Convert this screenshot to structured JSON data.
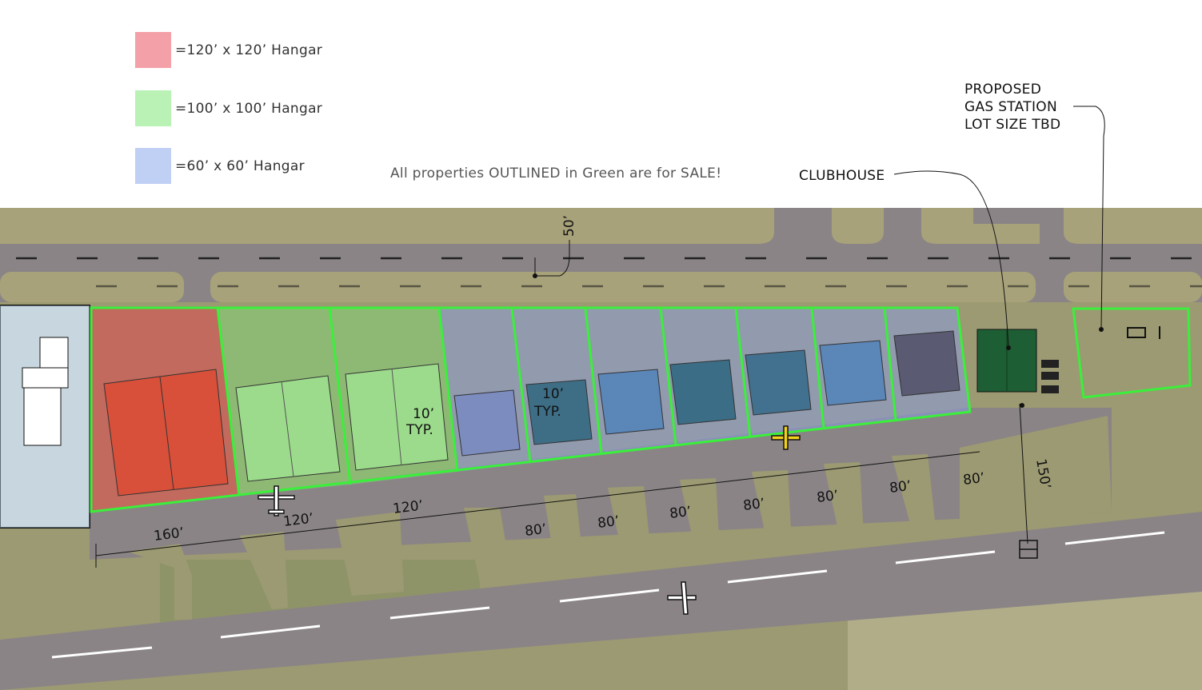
{
  "legend": [
    {
      "label": "=120’ x 120’ Hangar",
      "color": "#f4a0a8"
    },
    {
      "label": "=100’ x 100’ Hangar",
      "color": "#b9f2b4"
    },
    {
      "label": "=60’ x 60’ Hangar",
      "color": "#c0cff4"
    }
  ],
  "note": "All properties OUTLINED in Green are for SALE!",
  "callouts": {
    "clubhouse": "CLUBHOUSE",
    "gas_station": [
      "PROPOSED",
      "GAS STATION",
      "LOT SIZE TBD"
    ]
  },
  "dimensions": {
    "road_width": "50’",
    "lot_depth": "150’",
    "lot_widths": [
      "160’",
      "120’",
      "120’",
      "80’",
      "80’",
      "80’",
      "80’",
      "80’",
      "80’",
      "80’"
    ],
    "spacing_label_1": [
      "10’",
      "TYP."
    ],
    "spacing_label_2": [
      "10’",
      "TYP."
    ]
  },
  "colors": {
    "sale_outline": "#3af03a",
    "large_hangar": "#d8503a",
    "medium_hangar": "#9cdb8c",
    "small_hangar": "#5b86b8",
    "clubhouse": "#1e5e34",
    "pavement": "#8a8486",
    "ground": "#9a9a70"
  },
  "icons": [
    "airplane-icon",
    "compass-icon",
    "fuel-pump-icon"
  ]
}
